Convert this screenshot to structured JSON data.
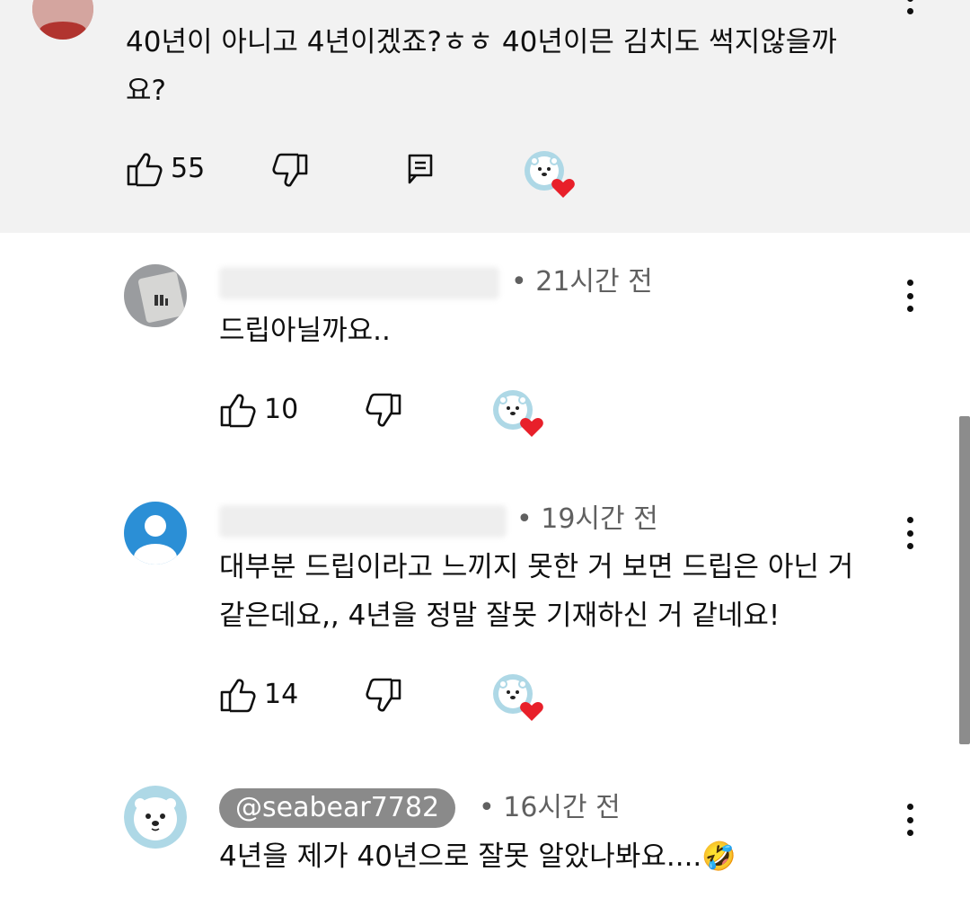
{
  "comments": [
    {
      "text_lines": [
        "40년이 아니고 4년이겠죠?ㅎㅎ 40년이믄 김치도 썩지않을까",
        "요?"
      ],
      "likes": "55"
    },
    {
      "time": "• 21시간 전",
      "text_lines": [
        "드립아닐까요.."
      ],
      "likes": "10"
    },
    {
      "time": "• 19시간 전",
      "text_lines": [
        "대부분 드립이라고 느끼지 못한 거 보면 드립은 아닌 거",
        "같은데요,, 4년을 정말 잘못 기재하신 거 같네요!"
      ],
      "likes": "14"
    },
    {
      "handle": "@seabear7782",
      "time": "• 16시간 전",
      "text_lines": [
        "4년을 제가 40년으로 잘못 알았나봐요....🤣"
      ]
    }
  ],
  "colors": {
    "highlight_bg": "#f2f2f2",
    "meta_gray": "#606060",
    "heart_red": "#e8202a",
    "bear_ring": "#aed8e6",
    "default_avatar_blue": "#2b8fd6"
  },
  "icons": [
    "thumbs-up-icon",
    "thumbs-down-icon",
    "reply-icon",
    "creator-heart-icon",
    "more-vert-icon"
  ]
}
